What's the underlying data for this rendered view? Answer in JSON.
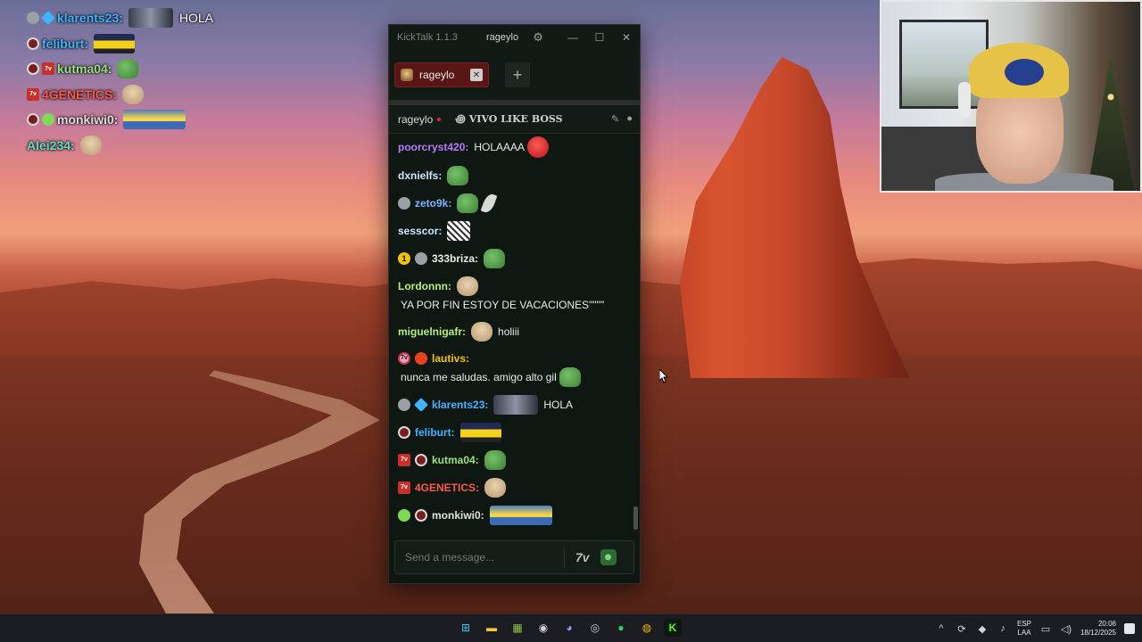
{
  "window": {
    "app_title": "KickTalk 1.1.3",
    "user": "rageylo"
  },
  "tabs": [
    {
      "label": "rageylo",
      "close": "✕"
    }
  ],
  "add_tab": "+",
  "channel": {
    "name": "rageylo",
    "stream_title": "VIVO LIKE BOSS..."
  },
  "messages": [
    {
      "user": "poorcryst420",
      "color": "#b57cff",
      "badges": [],
      "emotes_before": [],
      "text": "HOLAAAA",
      "emotes_after": [
        "angry"
      ]
    },
    {
      "user": "dxnielfs",
      "color": "#cfe7ff",
      "badges": [],
      "emotes_before": [],
      "text": "",
      "emotes_after": [
        "pepe"
      ]
    },
    {
      "user": "zeto9k",
      "color": "#7fb5ff",
      "badges": [
        "gray"
      ],
      "emotes_before": [],
      "text": "",
      "emotes_after": [
        "pepe",
        "leaf"
      ]
    },
    {
      "user": "sesscor",
      "color": "#cfe7ff",
      "badges": [],
      "emotes_before": [],
      "text": "",
      "emotes_after": [
        "meme"
      ]
    },
    {
      "user": "333briza",
      "color": "#e9ecea",
      "badges": [
        "gold",
        "gray"
      ],
      "emotes_before": [],
      "text": "",
      "emotes_after": [
        "pepe"
      ]
    },
    {
      "user": "Lordonnn",
      "color": "#b6f07a",
      "badges": [],
      "emotes_before": [],
      "text": "YA POR FIN ESTOY DE VACACIONES\"\"\"\"",
      "emotes_after": [
        "cat"
      ]
    },
    {
      "user": "miguelnigafr",
      "color": "#b6f07a",
      "badges": [],
      "emotes_before": [],
      "text": "holiii",
      "emotes_after": [
        "cat"
      ]
    },
    {
      "user": "lautivs",
      "color": "#f2c400",
      "badges": [
        "pink",
        "fire"
      ],
      "emotes_before": [],
      "text": "nunca me saludas. amigo alto gil",
      "emotes_after": [
        "pepe"
      ]
    },
    {
      "user": "klarents23",
      "color": "#3fb4ff",
      "badges": [
        "gray",
        "blue"
      ],
      "emotes_before": [],
      "text": "HOLA",
      "emotes_after": [
        "wolf"
      ]
    },
    {
      "user": "feliburt",
      "color": "#3fb4ff",
      "badges": [
        "dark"
      ],
      "emotes_before": [],
      "text": "",
      "emotes_after": [
        "car"
      ]
    },
    {
      "user": "kutma04",
      "color": "#9be07f",
      "badges": [
        "red",
        "dark"
      ],
      "emotes_before": [],
      "text": "",
      "emotes_after": [
        "pepe"
      ]
    },
    {
      "user": "4GENETICS",
      "color": "#ff5a4e",
      "badges": [
        "red"
      ],
      "emotes_before": [],
      "text": "",
      "emotes_after": [
        "cat"
      ]
    },
    {
      "user": "monkiwi0",
      "color": "#e0e0e0",
      "badges": [
        "green",
        "dark"
      ],
      "emotes_before": [],
      "text": "",
      "emotes_after": [
        "minion"
      ]
    },
    {
      "user": "Alei234",
      "color": "#5fe0c5",
      "badges": [],
      "emotes_before": [],
      "text": "",
      "emotes_after": [
        "cat"
      ]
    }
  ],
  "composer": {
    "placeholder": "Send a message...",
    "seven_tv": "7v"
  },
  "overlay": [
    {
      "user": "klarents23",
      "color": "#3fb4ff",
      "badges": [
        "gray",
        "blue"
      ],
      "text": "HOLA",
      "emotes": [
        "wolf"
      ]
    },
    {
      "user": "feliburt",
      "color": "#3fb4ff",
      "badges": [
        "dark"
      ],
      "text": "",
      "emotes": [
        "car"
      ]
    },
    {
      "user": "kutma04",
      "color": "#9be07f",
      "badges": [
        "dark",
        "red"
      ],
      "text": "",
      "emotes": [
        "pepe"
      ]
    },
    {
      "user": "4GENETICS",
      "color": "#ff5a4e",
      "badges": [
        "red"
      ],
      "text": "",
      "emotes": [
        "cat"
      ]
    },
    {
      "user": "monkiwi0",
      "color": "#e0e0e0",
      "badges": [
        "dark",
        "green"
      ],
      "text": "",
      "emotes": [
        "minion"
      ]
    },
    {
      "user": "Alei234",
      "color": "#5fe0c5",
      "badges": [],
      "text": "",
      "emotes": [
        "cat"
      ]
    }
  ],
  "taskbar": {
    "apps": [
      {
        "name": "windows-start-icon",
        "glyph": "⊞",
        "color": "#4cc2ff"
      },
      {
        "name": "file-explorer-icon",
        "glyph": "▬",
        "color": "#f4c542"
      },
      {
        "name": "game-app-icon",
        "glyph": "▦",
        "color": "#8bc34a"
      },
      {
        "name": "steam-icon",
        "glyph": "◉",
        "color": "#c7d5e0"
      },
      {
        "name": "discord-icon",
        "glyph": "◕",
        "color": "#8c9eff"
      },
      {
        "name": "obs-icon",
        "glyph": "◎",
        "color": "#d0d0d0"
      },
      {
        "name": "spotify-icon",
        "glyph": "●",
        "color": "#1ed760"
      },
      {
        "name": "chrome-icon",
        "glyph": "◍",
        "color": "#f4b400"
      },
      {
        "name": "kicktalk-icon",
        "glyph": "K",
        "color": "#53fc18"
      }
    ],
    "lang_top": "ESP",
    "lang_bottom": "LAA",
    "time": "20:06",
    "date": "18/12/2025"
  }
}
